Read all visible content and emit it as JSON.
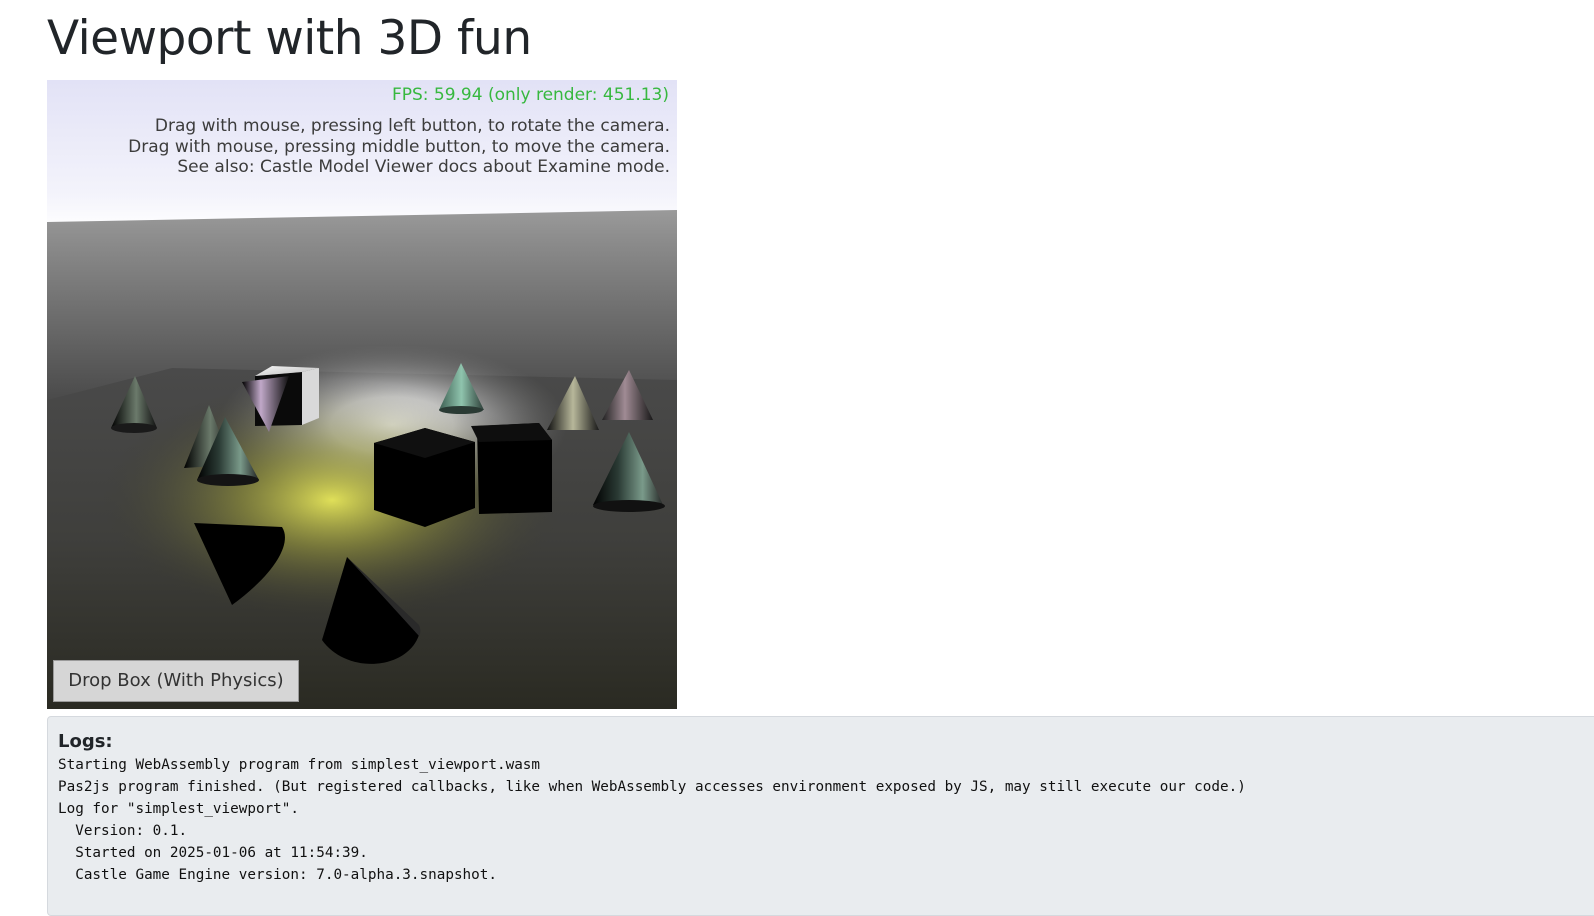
{
  "page": {
    "title": "Viewport with 3D fun"
  },
  "viewport": {
    "fps_text": "FPS: 59.94 (only render: 451.13)",
    "help_lines": [
      "Drag with mouse, pressing left button, to rotate the camera.",
      "Drag with mouse, pressing middle button, to move the camera.",
      "See also: Castle Model Viewer docs about Examine mode."
    ],
    "drop_button_label": "Drop Box (With Physics)",
    "colors": {
      "fps": "#37b83f",
      "help_text": "#3c3c3c",
      "sky": "#e8e8f6",
      "spotlight": "#e6e65a"
    }
  },
  "logs": {
    "title": "Logs:",
    "lines": [
      "Starting WebAssembly program from simplest_viewport.wasm",
      "Pas2js program finished. (But registered callbacks, like when WebAssembly accesses environment exposed by JS, may still execute our code.)",
      "Log for \"simplest_viewport\".",
      "  Version: 0.1.",
      "  Started on 2025-01-06 at 11:54:39.",
      "  Castle Game Engine version: 7.0-alpha.3.snapshot."
    ]
  }
}
